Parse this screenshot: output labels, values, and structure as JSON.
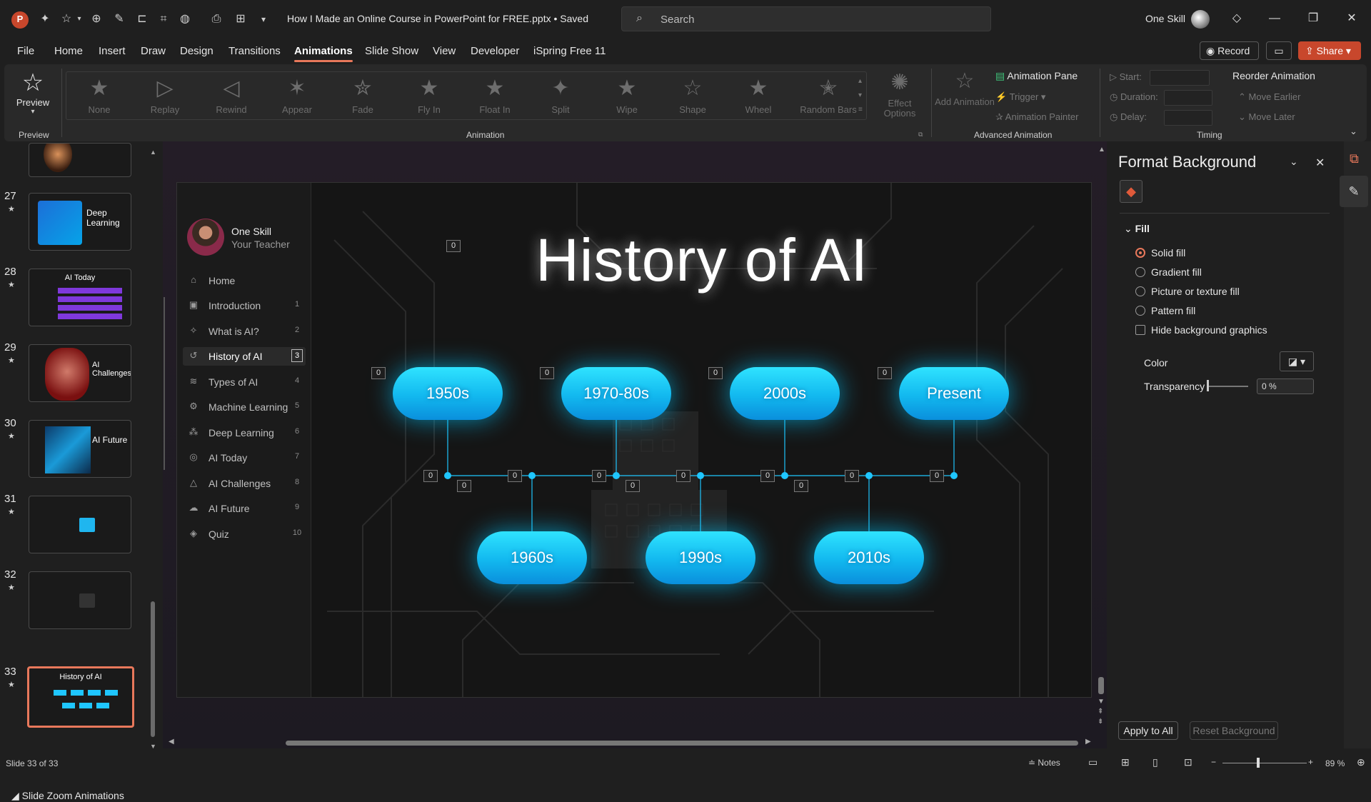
{
  "app": {
    "title": "How I Made an Online Course in PowerPoint for FREE.pptx • Saved",
    "user": "One Skill"
  },
  "search": {
    "placeholder": "Search"
  },
  "menu": [
    "File",
    "Home",
    "Insert",
    "Draw",
    "Design",
    "Transitions",
    "Animations",
    "Slide Show",
    "View",
    "Developer",
    "iSpring Free 11"
  ],
  "menu_active": "Animations",
  "top_buttons": {
    "record": "Record",
    "share": "Share"
  },
  "ribbon": {
    "preview_label": "Preview",
    "preview_group": "Preview",
    "animations": [
      "None",
      "Replay",
      "Rewind",
      "Appear",
      "Fade",
      "Fly In",
      "Float In",
      "Split",
      "Wipe",
      "Shape",
      "Wheel",
      "Random Bars"
    ],
    "animation_group": "Animation",
    "effect_options": "Effect Options",
    "add_animation": "Add Animation",
    "animation_pane": "Animation Pane",
    "trigger": "Trigger",
    "animation_painter": "Animation Painter",
    "advanced_group": "Advanced Animation",
    "start": "Start:",
    "duration": "Duration:",
    "delay": "Delay:",
    "reorder": "Reorder Animation",
    "move_earlier": "Move Earlier",
    "move_later": "Move Later",
    "timing_group": "Timing"
  },
  "thumbnails": [
    {
      "num": "27",
      "title": "Deep Learning"
    },
    {
      "num": "28",
      "title": "AI Today"
    },
    {
      "num": "29",
      "title": "AI Challenges"
    },
    {
      "num": "30",
      "title": "AI Future"
    },
    {
      "num": "31",
      "title": ""
    },
    {
      "num": "32",
      "title": ""
    },
    {
      "num": "33",
      "title": "History of AI"
    }
  ],
  "section_label": "Slide Zoom Animations",
  "slide": {
    "name": "One Skill",
    "role": "Your Teacher",
    "title": "History of AI",
    "nav": [
      {
        "label": "Home",
        "num": "",
        "icon": "⌂"
      },
      {
        "label": "Introduction",
        "num": "1",
        "icon": "▣"
      },
      {
        "label": "What is AI?",
        "num": "2",
        "icon": "✧"
      },
      {
        "label": "History of AI",
        "num": "3",
        "icon": "↺"
      },
      {
        "label": "Types of AI",
        "num": "4",
        "icon": "≋"
      },
      {
        "label": "Machine Learning",
        "num": "5",
        "icon": "⚙"
      },
      {
        "label": "Deep Learning",
        "num": "6",
        "icon": "⁂"
      },
      {
        "label": "AI Today",
        "num": "7",
        "icon": "◎"
      },
      {
        "label": "AI Challenges",
        "num": "8",
        "icon": "△"
      },
      {
        "label": "AI Future",
        "num": "9",
        "icon": "☁"
      },
      {
        "label": "Quiz",
        "num": "10",
        "icon": "◈"
      }
    ],
    "eras_top": [
      "1950s",
      "1970-80s",
      "2000s",
      "Present"
    ],
    "eras_bottom": [
      "1960s",
      "1990s",
      "2010s"
    ],
    "tag": "0"
  },
  "format_panel": {
    "title": "Format Background",
    "fill": "Fill",
    "options": [
      "Solid fill",
      "Gradient fill",
      "Picture or texture fill",
      "Pattern fill"
    ],
    "hide_graphics": "Hide background graphics",
    "color": "Color",
    "transparency": "Transparency",
    "transparency_value": "0 %",
    "apply_all": "Apply to All",
    "reset": "Reset Background"
  },
  "status": {
    "slide": "Slide 33 of 33",
    "notes": "Notes",
    "zoom": "89 %"
  }
}
